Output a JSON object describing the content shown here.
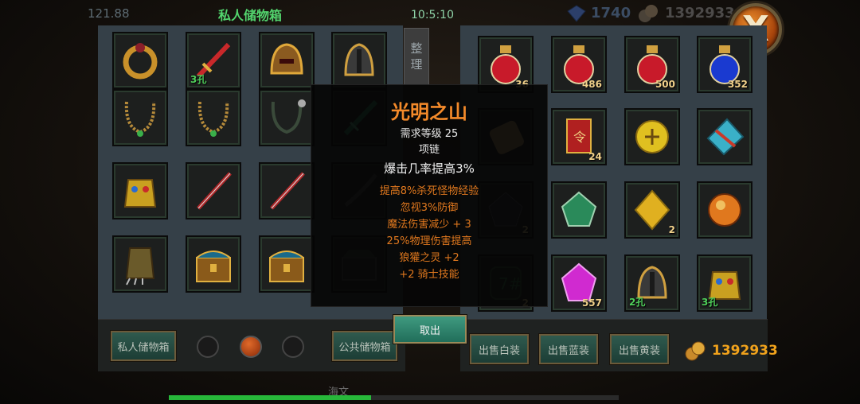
{
  "hud": {
    "left_value": "121.88",
    "clock": "10:5:10",
    "gems": "1740",
    "gold": "1392933",
    "close_label": "X"
  },
  "private_storage": {
    "title": "私人储物箱",
    "sort_label": [
      "整",
      "理"
    ],
    "slots": [
      {
        "icon": "ring-icon",
        "count": "",
        "holes": ""
      },
      {
        "icon": "red-sword-icon",
        "count": "",
        "holes": "3孔"
      },
      {
        "icon": "helmet-icon",
        "count": "",
        "holes": ""
      },
      {
        "icon": "dark-helmet-icon",
        "count": "",
        "holes": ""
      },
      {
        "icon": "necklace-icon",
        "count": "",
        "holes": ""
      },
      {
        "icon": "necklace-icon",
        "count": "",
        "holes": ""
      },
      {
        "icon": "necklace-dark-icon",
        "count": "",
        "holes": ""
      },
      {
        "icon": "jade-sword-icon",
        "count": "",
        "holes": ""
      },
      {
        "icon": "gold-armor-icon",
        "count": "",
        "holes": ""
      },
      {
        "icon": "red-blade-icon",
        "count": "",
        "holes": ""
      },
      {
        "icon": "red-blade-icon",
        "count": "",
        "holes": ""
      },
      {
        "icon": "dark-blade-icon",
        "count": "",
        "holes": ""
      },
      {
        "icon": "gauntlet-icon",
        "count": "",
        "holes": ""
      },
      {
        "icon": "treasure-chest-icon",
        "count": "",
        "holes": ""
      },
      {
        "icon": "treasure-chest-icon",
        "count": "",
        "holes": ""
      },
      {
        "icon": "dark-chest-icon",
        "count": "",
        "holes": ""
      }
    ]
  },
  "public_storage": {
    "slots": [
      {
        "icon": "red-potion-icon",
        "count": "36",
        "holes": ""
      },
      {
        "icon": "red-potion-icon",
        "count": "486",
        "holes": ""
      },
      {
        "icon": "red-potion-icon",
        "count": "500",
        "holes": ""
      },
      {
        "icon": "blue-potion-icon",
        "count": "352",
        "holes": ""
      },
      {
        "icon": "scroll-icon",
        "count": "",
        "holes": ""
      },
      {
        "icon": "red-scroll-icon",
        "count": "24",
        "holes": ""
      },
      {
        "icon": "gold-medal-icon",
        "count": "",
        "holes": ""
      },
      {
        "icon": "blue-rune-icon",
        "count": "",
        "holes": ""
      },
      {
        "icon": "dark-gem-icon",
        "count": "2",
        "holes": ""
      },
      {
        "icon": "green-gem-icon",
        "count": "",
        "holes": ""
      },
      {
        "icon": "yellow-gem-icon",
        "count": "2",
        "holes": ""
      },
      {
        "icon": "orange-orb-icon",
        "count": "",
        "holes": ""
      },
      {
        "icon": "rune-stone-icon",
        "count": "2",
        "holes": ""
      },
      {
        "icon": "purple-gem-icon",
        "count": "557",
        "holes": ""
      },
      {
        "icon": "dark-helmet-icon",
        "count": "",
        "holes": "2孔"
      },
      {
        "icon": "gold-armor-icon",
        "count": "",
        "holes": "3孔"
      }
    ]
  },
  "tooltip": {
    "name": "光明之山",
    "level_req": "需求等级 25",
    "type": "项链",
    "main_stat": "爆击几率提高3%",
    "extra_stats": [
      "提高8%杀死怪物经验",
      "忽视3%防御",
      "魔法伤害减少 + 3",
      "25%物理伤害提高",
      "狼獾之灵 +2",
      "+2 骑士技能"
    ]
  },
  "bottom": {
    "private_button": "私人储物箱",
    "public_button": "公共储物箱",
    "take_out_button": "取出",
    "sell_white": "出售白装",
    "sell_blue": "出售蓝装",
    "sell_yellow": "出售黄装",
    "gold": "1392933",
    "page_dots": 3,
    "active_page": 1
  },
  "progress": {
    "label": "海文",
    "fraction": 0.45
  },
  "colors": {
    "panel": "#354048",
    "title_green": "#52d46d",
    "tooltip_orange": "#f48a2a",
    "gold": "#f0a21c"
  }
}
